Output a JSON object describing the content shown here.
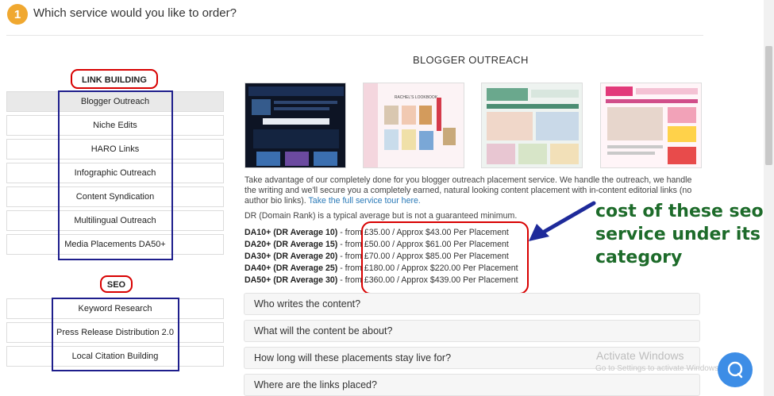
{
  "step": {
    "number": "1",
    "title": "Which service would you like to order?"
  },
  "categories": {
    "link_building": {
      "label": "LINK BUILDING",
      "items": [
        "Blogger Outreach",
        "Niche Edits",
        "HARO Links",
        "Infographic Outreach",
        "Content Syndication",
        "Multilingual Outreach",
        "Media Placements DA50+"
      ],
      "active_index": 0
    },
    "seo": {
      "label": "SEO",
      "items": [
        "Keyword Research",
        "Press Release Distribution 2.0",
        "Local Citation Building"
      ]
    }
  },
  "main": {
    "title": "BLOGGER OUTREACH",
    "description": "Take advantage of our completely done for you blogger outreach placement service. We handle the outreach, we handle the writing and we'll secure you a completely earned, natural looking content placement with in-content editorial links (no author bio links).",
    "tour_link": "Take the full service tour here.",
    "dr_note": "DR (Domain Rank) is a typical average but is not a guaranteed minimum.",
    "prices": [
      {
        "tier": "DA10+ (DR Average 10)",
        "price": " - from £35.00 / Approx $43.00 Per Placement"
      },
      {
        "tier": "DA20+ (DR Average 15)",
        "price": " - from £50.00 / Approx $61.00 Per Placement"
      },
      {
        "tier": "DA30+ (DR Average 20)",
        "price": " - from £70.00 / Approx $85.00 Per Placement"
      },
      {
        "tier": "DA40+ (DR Average 25)",
        "price": " - from £180.00 / Approx $220.00 Per Placement"
      },
      {
        "tier": "DA50+ (DR Average 30)",
        "price": " - from £360.00 / Approx $439.00 Per Placement"
      }
    ],
    "faqs": [
      "Who writes the content?",
      "What will the content be about?",
      "How long will these placements stay live for?",
      "Where are the links placed?"
    ],
    "thumbnail_texts": {
      "lookbook": "RACHEL'S LOOKBOOK"
    }
  },
  "annotation": {
    "line1": "cost of these seo",
    "line2": "service under its",
    "line3": "category"
  },
  "watermark": {
    "title": "Activate Windows",
    "subtitle": "Go to Settings to activate Windows."
  },
  "colors": {
    "accent": "#f0a830",
    "annotation_red": "#d80000",
    "annotation_blue": "#1e1e8c",
    "annotation_text": "#1d6b2a",
    "link": "#2a7ab8",
    "chat": "#3d8de6"
  },
  "icons": {
    "chat": "chat-bubble-icon",
    "arrow": "arrow-pointer-icon"
  }
}
